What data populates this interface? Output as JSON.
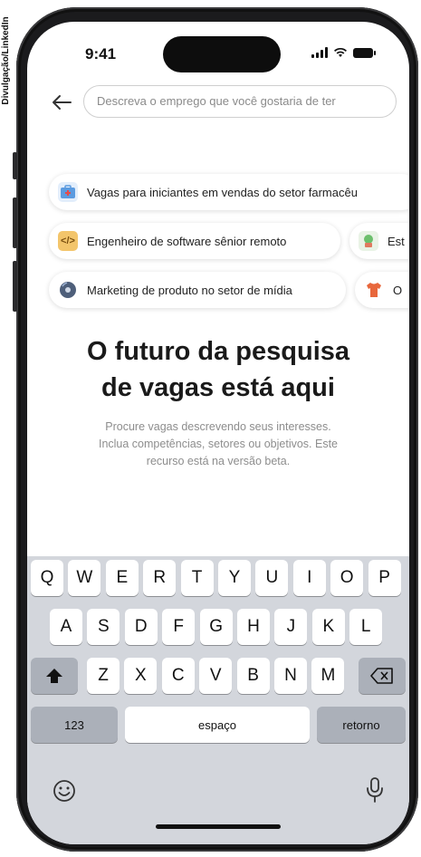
{
  "credit": "Divulgação/LinkedIn",
  "status_bar": {
    "time": "9:41"
  },
  "search": {
    "placeholder": "Descreva o emprego que você gostaria de ter"
  },
  "suggestions": [
    {
      "label": "Vagas para iniciantes em vendas do setor farmacêu",
      "icon": "medical-bag-icon"
    },
    {
      "label": "Engenheiro de software sênior remoto",
      "icon": "code-icon"
    },
    {
      "label": "Est",
      "icon": "plant-icon"
    },
    {
      "label": "Marketing de produto no setor de mídia",
      "icon": "disc-icon"
    },
    {
      "label": "O",
      "icon": "shirt-icon"
    }
  ],
  "headline": {
    "line1": "O futuro da pesquisa",
    "line2": "de vagas está aqui"
  },
  "description": {
    "line1": "Procure vagas descrevendo seus interesses.",
    "line2": "Inclua competências, setores ou objetivos. Este",
    "line3": "recurso está na versão beta."
  },
  "keyboard": {
    "row1": [
      "Q",
      "W",
      "E",
      "R",
      "T",
      "Y",
      "U",
      "I",
      "O",
      "P"
    ],
    "row2": [
      "A",
      "S",
      "D",
      "F",
      "G",
      "H",
      "J",
      "K",
      "L"
    ],
    "row3": [
      "Z",
      "X",
      "C",
      "V",
      "B",
      "N",
      "M"
    ],
    "numbers_label": "123",
    "space_label": "espaço",
    "return_label": "retorno"
  }
}
